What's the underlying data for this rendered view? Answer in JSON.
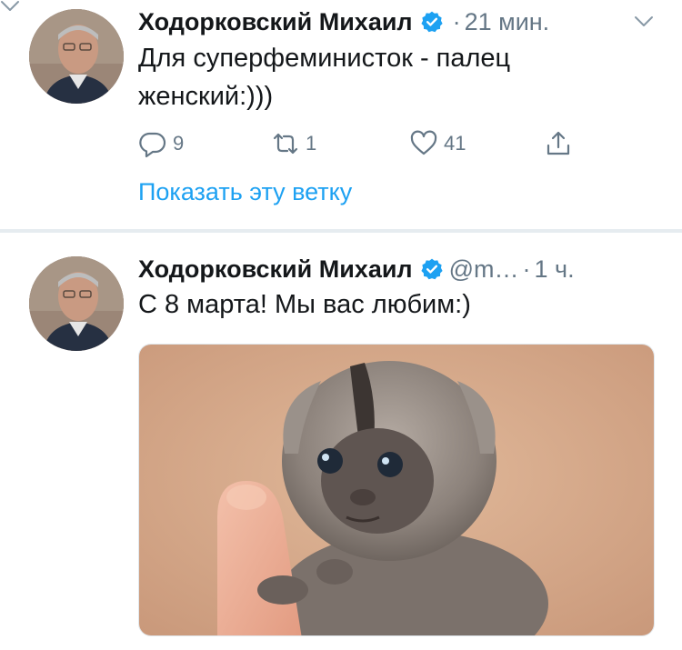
{
  "tweets": [
    {
      "author": "Ходорковский Михаил",
      "handle": "",
      "dot": "·",
      "time": "21 мин.",
      "text_line1": "Для суперфеминисток - палец",
      "text_line2": "женский:)))",
      "replies": "9",
      "retweets": "1",
      "likes": "41",
      "thread_link": "Показать эту ветку"
    },
    {
      "author": "Ходорковский Михаил",
      "handle": "@m…",
      "dot": "·",
      "time": "1 ч.",
      "text_line1": "С 8 марта! Мы вас любим:)"
    }
  ],
  "icons": {
    "verified": "verified-badge-icon",
    "chevron": "chevron-down-icon",
    "reply": "reply-icon",
    "retweet": "retweet-icon",
    "like": "heart-icon",
    "share": "share-icon"
  },
  "colors": {
    "accent": "#1da1f2",
    "secondary_text": "#657786",
    "divider": "#e6ecf0"
  }
}
